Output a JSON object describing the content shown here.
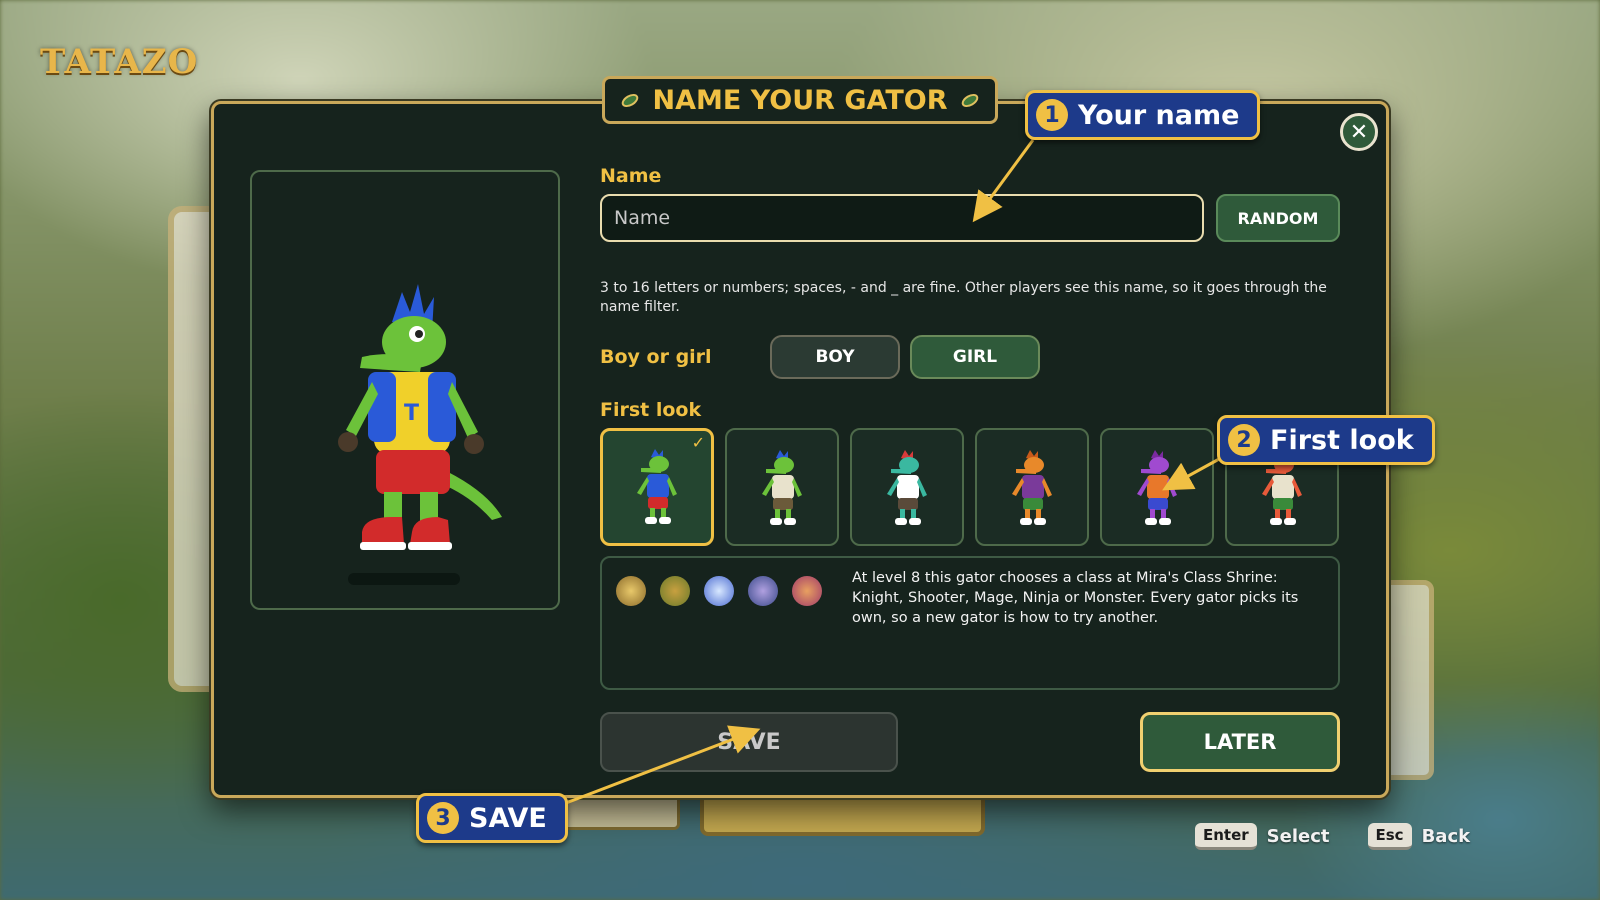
{
  "brand": {
    "logo": "TATAZO"
  },
  "modal": {
    "title": "NAME YOUR GATOR",
    "close_icon": "close-icon",
    "name_label": "Name",
    "name_placeholder": "Name",
    "name_value": "",
    "random_label": "RANDOM",
    "help_text": "3 to 16 letters or numbers; spaces, - and _ are fine. Other players see this name, so it goes through the name filter.",
    "gender_label": "Boy or girl",
    "gender_options": [
      "BOY",
      "GIRL"
    ],
    "gender_selected": "GIRL",
    "first_look_label": "First look",
    "looks": [
      {
        "skin": "#6cc23a",
        "hair": "#2a5ad8",
        "top": "#2a5ad8",
        "shorts": "#d22b2b",
        "selected": true
      },
      {
        "skin": "#6cc23a",
        "hair": "#2a5ad8",
        "top": "#e8e2cc",
        "shorts": "#6b5a3a",
        "selected": false
      },
      {
        "skin": "#3ab8a0",
        "hair": "#d83a3a",
        "top": "#ffffff",
        "shorts": "#5a4a3a",
        "selected": false
      },
      {
        "skin": "#e8892a",
        "hair": "#c85a1a",
        "top": "#7a3a9a",
        "shorts": "#3a8a3a",
        "selected": false
      },
      {
        "skin": "#a04ad0",
        "hair": "#7a2aa0",
        "top": "#e8782a",
        "shorts": "#3a4ad0",
        "selected": false
      },
      {
        "skin": "#e85a3a",
        "hair": "#c83a2a",
        "top": "#e8e2cc",
        "shorts": "#3a8a3a",
        "selected": false
      }
    ],
    "class_icons": [
      "knight-icon",
      "shooter-icon",
      "mage-icon",
      "ninja-icon",
      "monster-icon"
    ],
    "class_description": "At level 8 this gator chooses a class at Mira's Class Shrine: Knight, Shooter, Mage, Ninja or Monster. Every gator picks its own, so a new gator is how to try another.",
    "save_label": "SAVE",
    "later_label": "LATER"
  },
  "callouts": [
    {
      "number": "1",
      "text": "Your name"
    },
    {
      "number": "2",
      "text": "First look"
    },
    {
      "number": "3",
      "text": "SAVE"
    }
  ],
  "hints": [
    {
      "key": "Enter",
      "action": "Select"
    },
    {
      "key": "Esc",
      "action": "Back"
    }
  ],
  "colors": {
    "accent": "#f0c044",
    "panel": "#16231d",
    "button_green": "#2f5a3a",
    "callout_blue": "#1d3a8a"
  }
}
